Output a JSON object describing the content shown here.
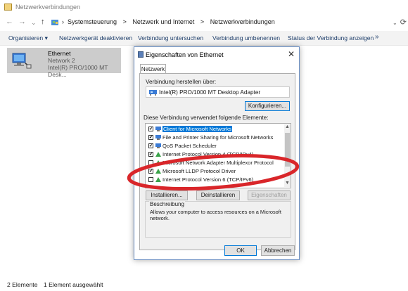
{
  "window": {
    "title": "Netzwerkverbindungen"
  },
  "nav": {
    "back": "←",
    "forward": "→",
    "history": "⌄",
    "up": "↑",
    "breadcrumb": [
      "Systemsteuerung",
      ">",
      "Netzwerk und Internet",
      ">",
      "Netzwerkverbindungen"
    ],
    "breadcrumb_prefix": "›",
    "refresh": "⟳",
    "dropdown": "⌄"
  },
  "toolbar": {
    "organize": "Organisieren ▾",
    "disable": "Netzwerkgerät deaktivieren",
    "diagnose": "Verbindung untersuchen",
    "rename": "Verbindung umbenennen",
    "status": "Status der Verbindung anzeigen",
    "more": "»"
  },
  "connection": {
    "name": "Ethernet",
    "network": "Network  2",
    "adapter": "Intel(R) PRO/1000 MT Desk..."
  },
  "statusbar": {
    "count": "2 Elemente",
    "selected": "1 Element ausgewählt"
  },
  "dialog": {
    "title": "Eigenschaften von Ethernet",
    "close": "✕",
    "tab": "Netzwerk",
    "connect_label": "Verbindung herstellen über:",
    "adapter": "Intel(R) PRO/1000 MT Desktop Adapter",
    "configure": "Konfigurieren...",
    "elements_label": "Diese Verbindung verwendet folgende Elemente:",
    "items": [
      {
        "label": "Client for Microsoft Networks",
        "checked": "✔"
      },
      {
        "label": "File and Printer Sharing for Microsoft Networks",
        "checked": "✔"
      },
      {
        "label": "QoS Packet Scheduler",
        "checked": "✔"
      },
      {
        "label": "Internet Protocol Version 4 (TCP/IPv4)",
        "checked": "✔"
      },
      {
        "label": "Microsoft Network Adapter Multiplexor Protocol",
        "checked": ""
      },
      {
        "label": "Microsoft LLDP Protocol Driver",
        "checked": "✔"
      },
      {
        "label": "Internet Protocol Version 6 (TCP/IPv6)",
        "checked": ""
      }
    ],
    "scroll_up": "▲",
    "scroll_down": "▼",
    "install": "Installieren...",
    "uninstall": "Deinstallieren",
    "properties": "Eigenschaften",
    "description_title": "Beschreibung",
    "description": "Allows your computer to access resources on a Microsoft network.",
    "ok": "OK",
    "cancel": "Abbrechen"
  },
  "colors": {
    "accent": "#0078d7",
    "annotation": "#d9262a",
    "link_text": "#1f3f6b"
  }
}
